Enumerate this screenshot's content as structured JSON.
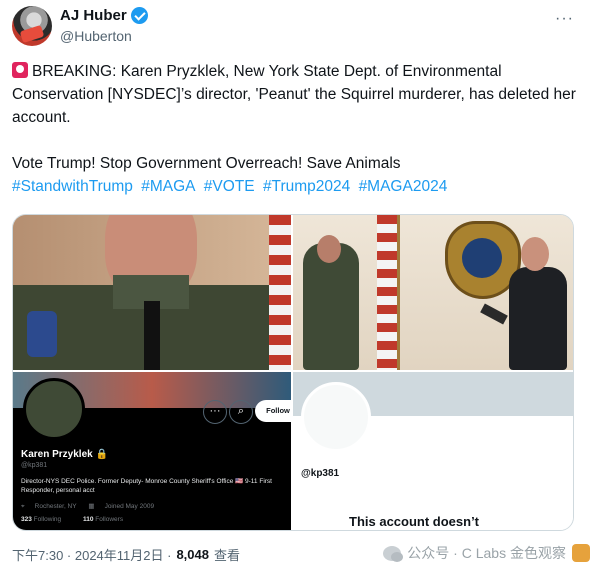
{
  "header": {
    "display_name": "AJ Huber",
    "handle": "@Huberton",
    "more_label": "···"
  },
  "tweet": {
    "line1": "BREAKING: Karen Pryzklek, New York State Dept. of Environmental Conservation [NYSDEC]’s director, 'Peanut' the Squirrel murderer, has deleted her account.",
    "line2": "Vote Trump! Stop Government Overreach! Save Animals",
    "hashtags": [
      "#StandwithTrump",
      "#MAGA",
      "#VOTE",
      "#Trump2024",
      "#MAGA2024"
    ]
  },
  "media": {
    "profile_card": {
      "name": "Karen Przyklek",
      "handle": "@kp381",
      "follow_label": "Follow",
      "bio": "Director-NYS DEC Police. Former Deputy- Monroe County Sheriff's Office 🇺🇸 9-11 First Responder, personal acct",
      "location": "Rochester, NY",
      "joined": "Joined May 2009",
      "following_count": "323",
      "following_label": "Following",
      "followers_count": "110",
      "followers_label": "Followers"
    },
    "deleted_card": {
      "handle": "@kp381",
      "message": "This account doesn’t"
    }
  },
  "footer": {
    "timestamp": "下午7:30 · 2024年11月2日 ·",
    "views": "8,048",
    "views_label": "查看"
  },
  "watermark": {
    "text": "公众号 · C Labs 金色观察"
  }
}
